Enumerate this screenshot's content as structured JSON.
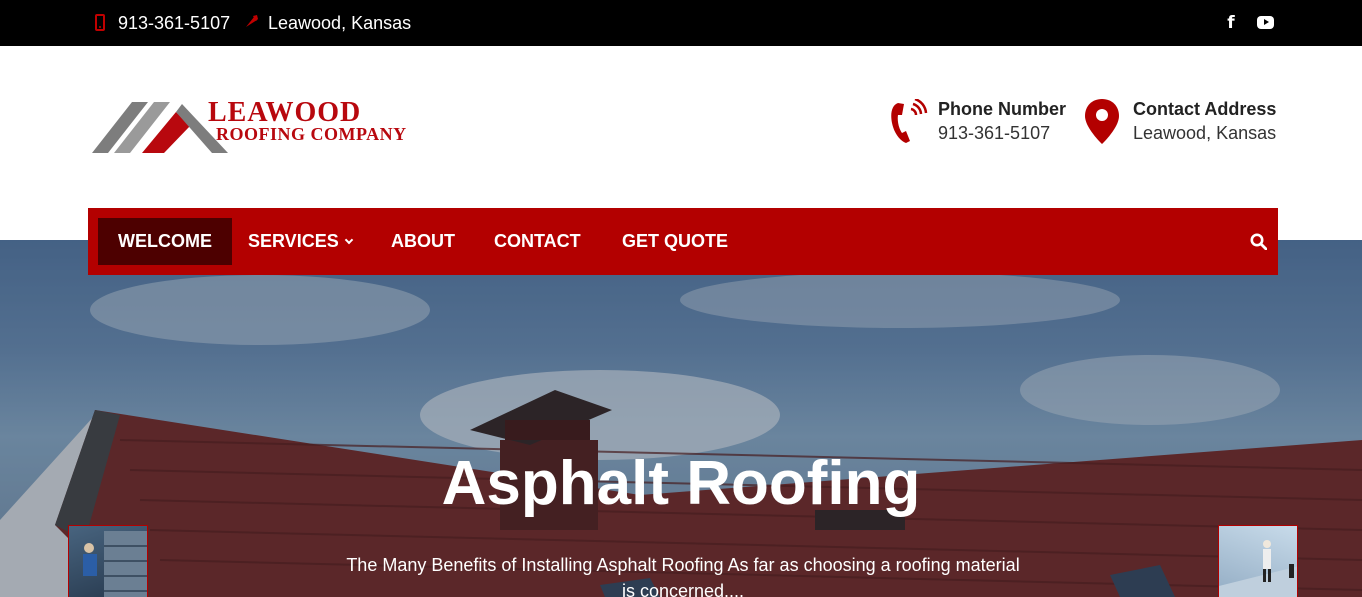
{
  "topbar": {
    "phone": "913-361-5107",
    "location": "Leawood, Kansas",
    "social": [
      "facebook-icon",
      "youtube-icon"
    ]
  },
  "logo": {
    "line1": "LEAWOOD",
    "line2": "ROOFING COMPANY"
  },
  "contact_info": {
    "phone_title": "Phone Number",
    "phone_value": "913-361-5107",
    "address_title": "Contact Address",
    "address_value": "Leawood, Kansas"
  },
  "nav": {
    "items": [
      {
        "label": "WELCOME",
        "active": true
      },
      {
        "label": "SERVICES",
        "dropdown": true
      },
      {
        "label": "ABOUT"
      },
      {
        "label": "CONTACT"
      },
      {
        "label": "GET QUOTE"
      }
    ],
    "search_icon": "search-icon"
  },
  "hero": {
    "title": "Asphalt Roofing",
    "text": "The Many Benefits of Installing Asphalt Roofing As far as choosing a roofing material is concerned...."
  },
  "colors": {
    "brand_red": "#b30000",
    "active_nav": "#4d0000",
    "topbar": "#000000"
  }
}
